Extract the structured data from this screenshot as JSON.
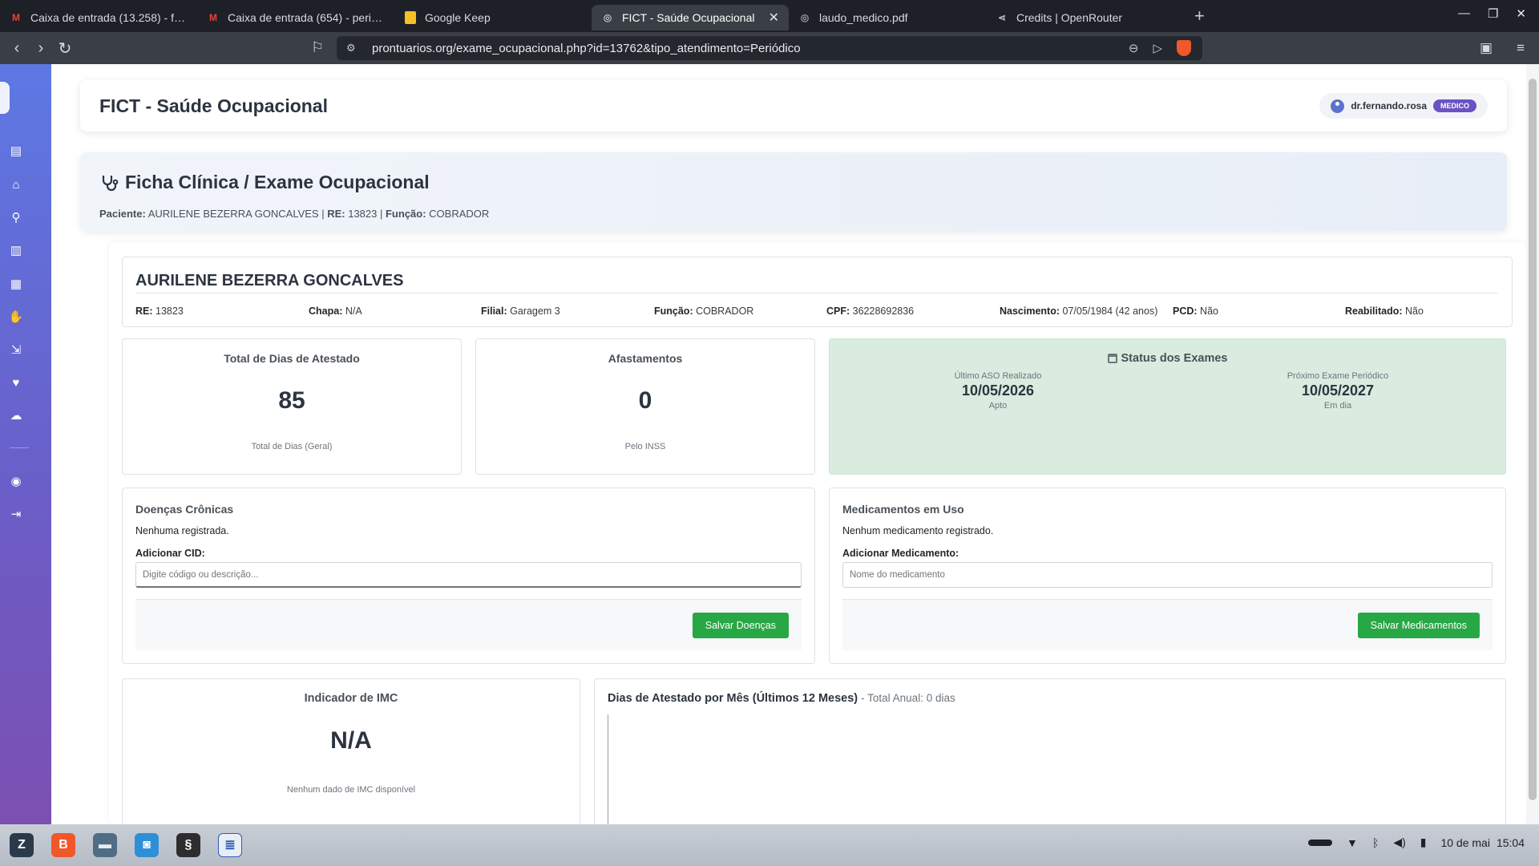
{
  "browser": {
    "tabs": [
      {
        "label": "Caixa de entrada (13.258) - fern",
        "icon": "gmail-icon",
        "color": "#ea4335"
      },
      {
        "label": "Caixa de entrada (654) - pericia",
        "icon": "gmail-icon",
        "color": "#ea4335"
      },
      {
        "label": "Google Keep",
        "icon": "keep-icon",
        "color": "#f6bf26"
      },
      {
        "label": "FICT - Saúde Ocupacional",
        "icon": "globe-icon",
        "color": "#9aa0a6",
        "active": true
      },
      {
        "label": "laudo_medico.pdf",
        "icon": "globe-icon",
        "color": "#9aa0a6"
      },
      {
        "label": "Credits | OpenRouter",
        "icon": "openrouter-icon",
        "color": "#9aa0a6"
      }
    ],
    "url": "prontuarios.org/exame_ocupacional.php?id=13762&tipo_atendimento=Periódico"
  },
  "header": {
    "title": "FICT - Saúde Ocupacional",
    "user": "dr.fernando.rosa",
    "role": "MEDICO"
  },
  "banner": {
    "title": "Ficha Clínica / Exame Ocupacional",
    "paciente_label": "Paciente:",
    "paciente": "AURILENE BEZERRA GONCALVES",
    "re_label": "RE:",
    "re": "13823",
    "funcao_label": "Função:",
    "funcao": "COBRADOR"
  },
  "patient": {
    "name": "AURILENE BEZERRA GONCALVES",
    "fields": [
      {
        "label": "RE:",
        "value": "13823"
      },
      {
        "label": "Chapa:",
        "value": "N/A"
      },
      {
        "label": "Filial:",
        "value": "Garagem 3"
      },
      {
        "label": "Função:",
        "value": "COBRADOR"
      },
      {
        "label": "CPF:",
        "value": "36228692836"
      },
      {
        "label": "Nascimento:",
        "value": "07/05/1984 (42 anos)"
      },
      {
        "label": "PCD:",
        "value": "Não"
      },
      {
        "label": "Reabilitado:",
        "value": "Não"
      }
    ]
  },
  "stats": {
    "atestado": {
      "title": "Total de Dias de Atestado",
      "value": "85",
      "foot": "Total de Dias (Geral)"
    },
    "afastamentos": {
      "title": "Afastamentos",
      "value": "0",
      "foot": "Pelo INSS"
    }
  },
  "status": {
    "title": "Status dos Exames",
    "ultimo": {
      "label": "Último ASO Realizado",
      "date": "10/05/2026",
      "sub": "Apto"
    },
    "proximo": {
      "label": "Próximo Exame Periódico",
      "date": "10/05/2027",
      "sub": "Em dia"
    },
    "bg_color": "#d9ecdf"
  },
  "doencas": {
    "title": "Doenças Crônicas",
    "empty": "Nenhuma registrada.",
    "label": "Adicionar CID:",
    "placeholder": "Digite código ou descrição...",
    "button": "Salvar Doenças"
  },
  "medicamentos": {
    "title": "Medicamentos em Uso",
    "empty": "Nenhum medicamento registrado.",
    "label": "Adicionar Medicamento:",
    "placeholder": "Nome do medicamento",
    "button": "Salvar Medicamentos"
  },
  "imc": {
    "title": "Indicador de IMC",
    "value": "N/A",
    "foot": "Nenhum dado de IMC disponível"
  },
  "chart": {
    "title": "Dias de Atestado por Mês (Últimos 12 Meses)",
    "subtitle": "- Total Anual: 0 dias"
  },
  "taskbar": {
    "date": "10 de mai",
    "time": "15:04"
  },
  "colors": {
    "accent_purple": "#6b52c2",
    "button_green": "#28a745",
    "sidebar_top": "#5d78e3",
    "sidebar_bottom": "#7c4fb1"
  }
}
